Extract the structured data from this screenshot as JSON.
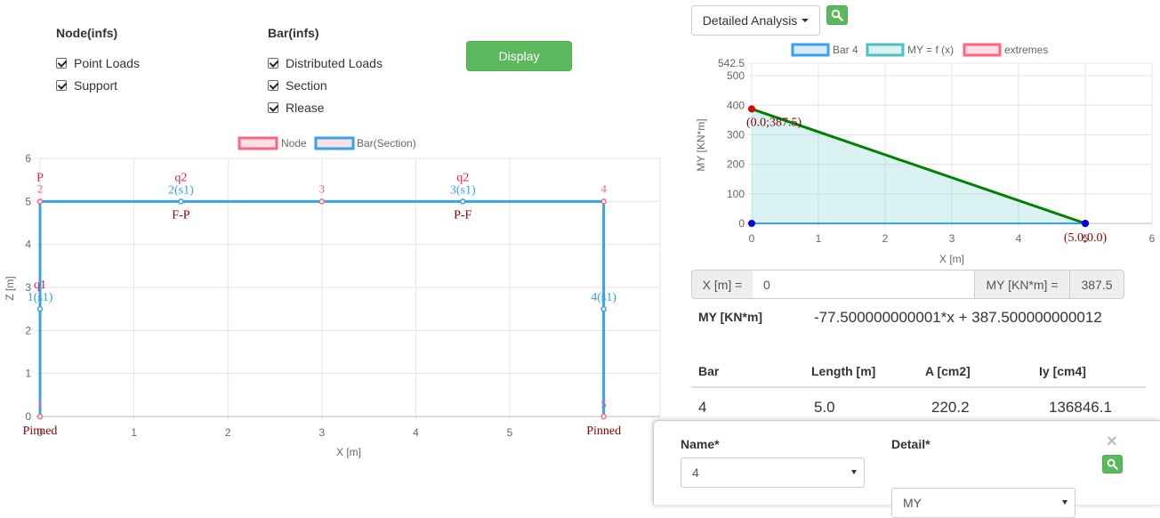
{
  "options": {
    "node_title": "Node(infs)",
    "node_items": [
      "Point Loads",
      "Support"
    ],
    "bar_title": "Bar(infs)",
    "bar_items": [
      "Distributed Loads",
      "Section",
      "Rlease"
    ],
    "display_label": "Display"
  },
  "structure_chart": {
    "legend": [
      "Node",
      "Bar(Section)"
    ],
    "xlabel": "X [m]",
    "ylabel": "Z [m]",
    "x_ticks": [
      "0",
      "1",
      "2",
      "3",
      "4",
      "5"
    ],
    "y_ticks": [
      "0",
      "1",
      "2",
      "3",
      "4",
      "5",
      "6"
    ],
    "xlim": [
      0,
      6.6
    ],
    "ylim": [
      0,
      6
    ],
    "nodes": [
      {
        "id": "1",
        "x": 0,
        "z": 0
      },
      {
        "id": "2",
        "x": 0,
        "z": 5
      },
      {
        "id": "3",
        "x": 3,
        "z": 5
      },
      {
        "id": "4",
        "x": 6,
        "z": 5
      },
      {
        "id": "5",
        "x": 6,
        "z": 0
      }
    ],
    "bars": [
      {
        "label": "1(s1)",
        "from": [
          0,
          0
        ],
        "to": [
          0,
          5
        ],
        "mid": [
          0,
          2.5
        ]
      },
      {
        "label": "2(s1)",
        "from": [
          0,
          5
        ],
        "to": [
          3,
          5
        ],
        "mid": [
          1.5,
          5
        ]
      },
      {
        "label": "3(s1)",
        "from": [
          3,
          5
        ],
        "to": [
          6,
          5
        ],
        "mid": [
          4.5,
          5
        ]
      },
      {
        "label": "4(s1)",
        "from": [
          6,
          5
        ],
        "to": [
          6,
          0
        ],
        "mid": [
          6,
          2.5
        ]
      }
    ],
    "load_labels": [
      {
        "text": "P",
        "x": 0,
        "z": 5
      },
      {
        "text": "q2",
        "x": 1.5,
        "z": 5
      },
      {
        "text": "q2",
        "x": 4.5,
        "z": 5
      },
      {
        "text": "q1",
        "x": 0,
        "z": 2.5
      }
    ],
    "release_labels": [
      {
        "text": "F-P",
        "x": 1.5,
        "z": 5
      },
      {
        "text": "P-F",
        "x": 4.5,
        "z": 5
      }
    ],
    "support_labels": [
      {
        "text": "Pinned",
        "x": 0,
        "z": 0
      },
      {
        "text": "Pinned",
        "x": 6,
        "z": 0
      }
    ],
    "colors": {
      "bar": "#36a2eb",
      "node": "#ff6384",
      "text_dark": "#8b0000"
    }
  },
  "analysis": {
    "dropdown_label": "Detailed Analysis",
    "search_icon": "search-icon"
  },
  "chart_data": {
    "type": "line",
    "title": "",
    "xlabel": "X [m]",
    "ylabel": "MY [KN*m]",
    "legend": [
      "Bar 4",
      "MY = f (x)",
      "extremes"
    ],
    "x_ticks": [
      "0",
      "1",
      "2",
      "3",
      "4",
      "5",
      "6"
    ],
    "y_ticks": [
      "0",
      "100",
      "200",
      "300",
      "400",
      "500",
      "542.5"
    ],
    "xlim": [
      0,
      6
    ],
    "ylim": [
      0,
      542.5
    ],
    "series": [
      {
        "name": "Bar 4",
        "x": [
          0,
          5
        ],
        "y": [
          0,
          0
        ]
      },
      {
        "name": "MY = f (x)",
        "x": [
          0,
          5
        ],
        "y": [
          387.5,
          0
        ]
      },
      {
        "name": "extremes",
        "x": [
          0,
          5
        ],
        "y": [
          387.5,
          0
        ]
      }
    ],
    "point_labels": [
      "(0.0;387.5)",
      "(5.0;0.0)"
    ],
    "colors": {
      "bar": "#36a2eb",
      "fill": "rgba(75,192,192,0.2)",
      "line": "#008000",
      "extreme_start": "#e00000",
      "extreme_end": "#0000e0"
    }
  },
  "query": {
    "x_label": "X [m] =",
    "x_value": "0",
    "my_label": "MY [KN*m] =",
    "my_value": "387.5"
  },
  "equation": {
    "label": "MY [KN*m]",
    "formula": "-77.500000000001*x + 387.500000000012"
  },
  "bar_table": {
    "headers": [
      "Bar",
      "Length [m]",
      "A [cm2]",
      "Iy [cm4]"
    ],
    "rows": [
      [
        "4",
        "5.0",
        "220.2",
        "136846.1"
      ]
    ]
  },
  "popup": {
    "name_label": "Name*",
    "name_value": "4",
    "detail_label": "Detail*",
    "detail_value": "MY",
    "close_glyph": "×"
  }
}
